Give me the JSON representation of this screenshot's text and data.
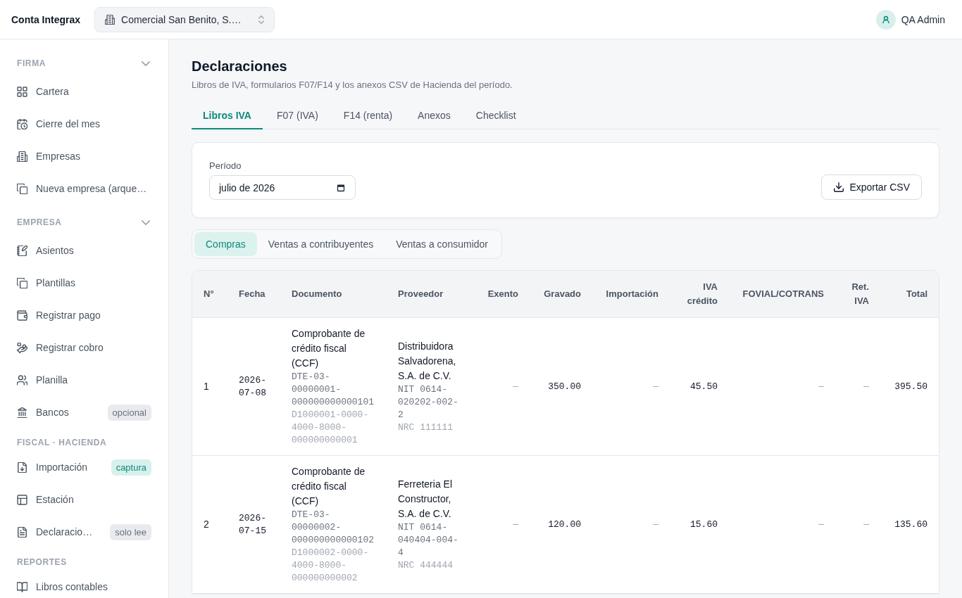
{
  "topbar": {
    "brand": "Conta Integrax",
    "company": "Comercial San Benito, S.…",
    "user": "QA Admin"
  },
  "sidebar": {
    "sections": [
      {
        "title": "FIRMA",
        "kind": "collapsible",
        "items": [
          {
            "label": "Cartera"
          },
          {
            "label": "Cierre del mes"
          },
          {
            "label": "Empresas"
          },
          {
            "label": "Nueva empresa (arque…"
          }
        ]
      },
      {
        "title": "EMPRESA",
        "kind": "collapsible",
        "items": [
          {
            "label": "Asientos"
          },
          {
            "label": "Plantillas"
          },
          {
            "label": "Registrar pago"
          },
          {
            "label": "Registrar cobro"
          },
          {
            "label": "Planilla"
          },
          {
            "label": "Bancos",
            "badge": {
              "label": "opcional",
              "kind": "neutral"
            }
          }
        ]
      },
      {
        "title": "FISCAL · HACIENDA",
        "kind": "label",
        "items": [
          {
            "label": "Importación",
            "badge": {
              "label": "captura",
              "kind": "accent"
            }
          },
          {
            "label": "Estación"
          },
          {
            "label": "Declaracio…",
            "badge": {
              "label": "solo lee",
              "kind": "neutral"
            }
          }
        ]
      },
      {
        "title": "REPORTES",
        "kind": "label",
        "items": [
          {
            "label": "Libros contables"
          }
        ]
      }
    ]
  },
  "page": {
    "title": "Declaraciones",
    "subtitle": "Libros de IVA, formularios F07/F14 y los anexos CSV de Hacienda del período.",
    "tabs": [
      {
        "label": "Libros IVA",
        "selected": true
      },
      {
        "label": "F07 (IVA)",
        "selected": false
      },
      {
        "label": "F14 (renta)",
        "selected": false
      },
      {
        "label": "Anexos",
        "selected": false
      },
      {
        "label": "Checklist",
        "selected": false
      }
    ]
  },
  "filters": {
    "period_label": "Período",
    "period_value": "julio de 2026",
    "export_label": "Exportar CSV"
  },
  "book_tabs": [
    {
      "label": "Compras",
      "selected": true
    },
    {
      "label": "Ventas a contribuyentes",
      "selected": false
    },
    {
      "label": "Ventas a consumidor",
      "selected": false
    }
  ],
  "table": {
    "columns": [
      {
        "label": "N°",
        "kind": "text"
      },
      {
        "label": "Fecha",
        "kind": "text"
      },
      {
        "label": "Documento",
        "kind": "text"
      },
      {
        "label": "Proveedor",
        "kind": "text"
      },
      {
        "label": "Exento",
        "kind": "number"
      },
      {
        "label": "Gravado",
        "kind": "number"
      },
      {
        "label": "Importación",
        "kind": "number"
      },
      {
        "label": "IVA crédito",
        "kind": "number"
      },
      {
        "label": "FOVIAL/COTRANS",
        "kind": "number"
      },
      {
        "label": "Ret. IVA",
        "kind": "number"
      },
      {
        "label": "Total",
        "kind": "number"
      }
    ],
    "rows": [
      {
        "cells": [
          {
            "kind": "plain",
            "text": "1"
          },
          {
            "kind": "date",
            "text": "2026-07-08"
          },
          {
            "kind": "stacked",
            "title": "Comprobante de crédito fiscal (CCF)",
            "lines": [
              "DTE-03-00000001-000000000000101",
              "D1000001-0000-4000-8000-000000000001"
            ]
          },
          {
            "kind": "stacked",
            "title": "Distribuidora Salvadorena, S.A. de C.V.",
            "lines": [
              "NIT 0614-020202-002-2",
              "NRC 111111"
            ]
          },
          {
            "kind": "empty",
            "text": "—"
          },
          {
            "kind": "amount",
            "text": "350.00"
          },
          {
            "kind": "empty",
            "text": "—"
          },
          {
            "kind": "amount",
            "text": "45.50"
          },
          {
            "kind": "empty",
            "text": "—"
          },
          {
            "kind": "empty",
            "text": "—"
          },
          {
            "kind": "amount",
            "text": "395.50"
          }
        ]
      },
      {
        "cells": [
          {
            "kind": "plain",
            "text": "2"
          },
          {
            "kind": "date",
            "text": "2026-07-15"
          },
          {
            "kind": "stacked",
            "title": "Comprobante de crédito fiscal (CCF)",
            "lines": [
              "DTE-03-00000002-000000000000102",
              "D1000002-0000-4000-8000-000000000002"
            ]
          },
          {
            "kind": "stacked",
            "title": "Ferreteria El Constructor, S.A. de C.V.",
            "lines": [
              "NIT 0614-040404-004-4",
              "NRC 444444"
            ]
          },
          {
            "kind": "empty",
            "text": "—"
          },
          {
            "kind": "amount",
            "text": "120.00"
          },
          {
            "kind": "empty",
            "text": "—"
          },
          {
            "kind": "amount",
            "text": "15.60"
          },
          {
            "kind": "empty",
            "text": "—"
          },
          {
            "kind": "empty",
            "text": "—"
          },
          {
            "kind": "amount",
            "text": "135.60"
          }
        ]
      }
    ]
  }
}
